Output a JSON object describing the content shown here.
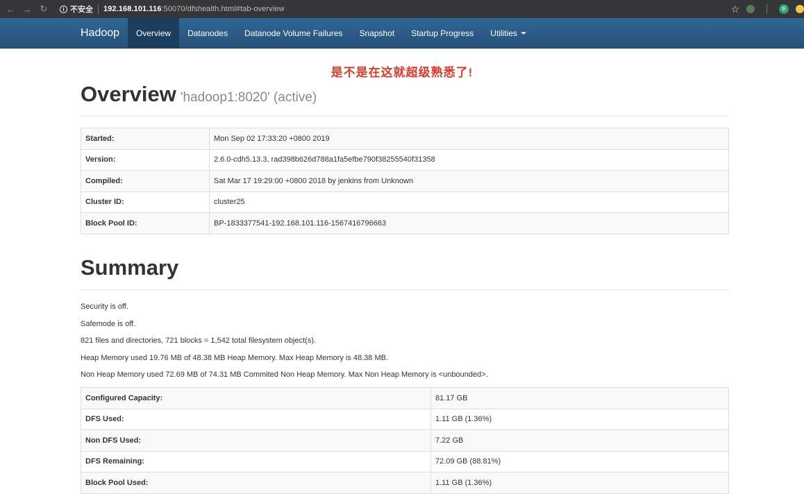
{
  "browser": {
    "security_label": "不安全",
    "url_host": "192.168.101.116",
    "url_rest": ":50070/dfshealth.html#tab-overview",
    "avatar_text": "析"
  },
  "navbar": {
    "brand": "Hadoop",
    "items": [
      {
        "label": "Overview"
      },
      {
        "label": "Datanodes"
      },
      {
        "label": "Datanode Volume Failures"
      },
      {
        "label": "Snapshot"
      },
      {
        "label": "Startup Progress"
      },
      {
        "label": "Utilities"
      }
    ]
  },
  "annotation": "是不是在这就超级熟悉了!",
  "overview": {
    "title": "Overview",
    "subtitle": "'hadoop1:8020' (active)",
    "rows": [
      {
        "label": "Started:",
        "value": "Mon Sep 02 17:33:20 +0800 2019"
      },
      {
        "label": "Version:",
        "value": "2.6.0-cdh5.13.3, rad398b626d788a1fa5efbe790f38255540f31358"
      },
      {
        "label": "Compiled:",
        "value": "Sat Mar 17 19:29:00 +0800 2018 by jenkins from Unknown"
      },
      {
        "label": "Cluster ID:",
        "value": "cluster25"
      },
      {
        "label": "Block Pool ID:",
        "value": "BP-1833377541-192.168.101.116-1567416796663"
      }
    ]
  },
  "summary": {
    "title": "Summary",
    "lines": [
      "Security is off.",
      "Safemode is off.",
      "821 files and directories, 721 blocks = 1,542 total filesystem object(s).",
      "Heap Memory used 19.76 MB of 48.38 MB Heap Memory. Max Heap Memory is 48.38 MB.",
      "Non Heap Memory used 72.69 MB of 74.31 MB Commited Non Heap Memory. Max Non Heap Memory is <unbounded>."
    ],
    "rows": [
      {
        "label": "Configured Capacity:",
        "value": "81.17 GB"
      },
      {
        "label": "DFS Used:",
        "value": "1.11 GB (1.36%)"
      },
      {
        "label": "Non DFS Used:",
        "value": "7.22 GB"
      },
      {
        "label": "DFS Remaining:",
        "value": "72.09 GB (88.81%)"
      },
      {
        "label": "Block Pool Used:",
        "value": "1.11 GB (1.36%)"
      }
    ]
  }
}
